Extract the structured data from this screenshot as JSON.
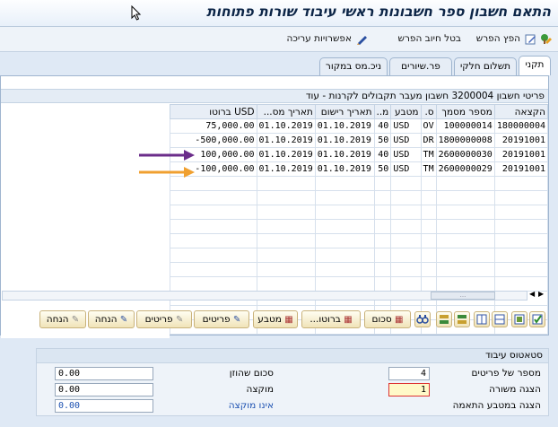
{
  "title": "התאם חשבון ספר חשבונות ראשי עיבוד שורות פתוחות",
  "toolbar": {
    "split_label": "הפץ הפרש",
    "cancel_label": "בטל חיוב הפרש",
    "edit_label": "אפשרויות עריכה"
  },
  "tabs": [
    "תקני",
    "תשלום חלקי",
    "פר.שיורים",
    "ניכ.מס במקור"
  ],
  "panel_title": "פריטי חשבון 3200004 חשבון מעבר תקבולים לקרנות - עוד",
  "grid": {
    "columns": [
      "הקצאה",
      "מספר מסמך",
      "ס.",
      "מטבע",
      "מ..",
      "תאריך רישום",
      "תאריך מס...",
      "USD ברוטו"
    ],
    "rows": [
      [
        "180000004",
        "100000014",
        "OV",
        "USD",
        "40",
        "01.10.2019",
        "01.10.2019",
        "75,000.00"
      ],
      [
        "20191001",
        "1800000008",
        "DR",
        "USD",
        "50",
        "01.10.2019",
        "01.10.2019",
        "-500,000.00"
      ],
      [
        "20191001",
        "2600000030",
        "TM",
        "USD",
        "40",
        "01.10.2019",
        "01.10.2019",
        "100,000.00"
      ],
      [
        "20191001",
        "2600000029",
        "TM",
        "USD",
        "50",
        "01.10.2019",
        "01.10.2019",
        "-100,000.00"
      ]
    ],
    "empty_rows": 11
  },
  "buttons": {
    "sum": "סכום",
    "gross": "ברוטו...",
    "currency": "מטבע",
    "items1": "פריטים",
    "items2": "פריטים",
    "discount1": "הנחה",
    "discount2": "הנחה"
  },
  "status": {
    "title": "סטאטוס עיבוד",
    "items_count_label": "מספר של פריטים",
    "items_count_value": "4",
    "row_display_label": "הצגה משורה",
    "row_display_value": "1",
    "currency_display_label": "הצגה במטבע התאמה",
    "entered_label": "סכום שהוזן",
    "entered_value": "0.00",
    "assigned_label": "מוקצה",
    "assigned_value": "0.00",
    "unassigned_label": "אינו מוקצה",
    "unassigned_value": "0.00"
  },
  "colors": {
    "arrow_purple": "#6b2d8a",
    "arrow_orange": "#f0a030",
    "unassigned_text": "#1a4fb0"
  }
}
